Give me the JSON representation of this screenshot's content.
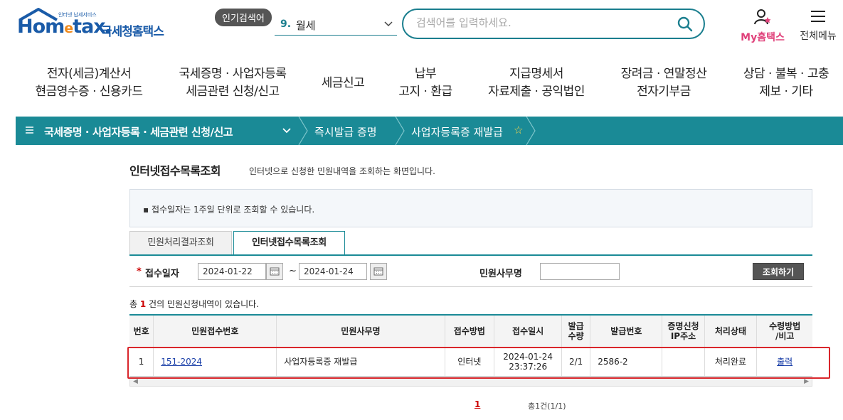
{
  "header": {
    "logo_main": "Hom",
    "logo_e": "e",
    "logo_rest": "tax.",
    "logo_small": "인터넷 납세서비스",
    "logo_sub": "국세청홈택스",
    "popular_badge": "인기검색어",
    "popular_num": "9.",
    "popular_text": "월세",
    "search_placeholder": "검색어를 입력하세요.",
    "my_hometax": "My홈택스",
    "all_menu": "전체메뉴"
  },
  "main_nav": [
    {
      "line1": "전자(세금)계산서",
      "line2": "현금영수증 · 신용카드"
    },
    {
      "line1": "국세증명 · 사업자등록",
      "line2": "세금관련 신청/신고"
    },
    {
      "line1": "세금신고",
      "line2": ""
    },
    {
      "line1": "납부",
      "line2": "고지 · 환급"
    },
    {
      "line1": "지급명세서",
      "line2": "자료제출 · 공익법인"
    },
    {
      "line1": "장려금 · 연말정산",
      "line2": "전자기부금"
    },
    {
      "line1": "상담 · 불복 · 고충",
      "line2": "제보 · 기타"
    }
  ],
  "breadcrumb": {
    "level1": "국세증명 · 사업자등록 · 세금관련 신청/신고",
    "level2": "즉시발급 증명",
    "level3": "사업자등록증 재발급",
    "star": "☆"
  },
  "page": {
    "title": "인터넷접수목록조회",
    "desc": "인터넷으로 신청한 민원내역을 조회하는 화면입니다.",
    "notice": "▪ 접수일자는 1주일 단위로 조회할 수 있습니다."
  },
  "tabs": [
    {
      "label": "민원처리결과조회"
    },
    {
      "label": "인터넷접수목록조회"
    }
  ],
  "filter": {
    "required_mark": "*",
    "date_label": "접수일자",
    "date_from": "2024-01-22",
    "tilde": "~",
    "date_to": "2024-01-24",
    "name_label": "민원사무명",
    "name_value": "",
    "search_button": "조회하기"
  },
  "count": {
    "prefix": "총 ",
    "num": "1",
    "suffix": " 건의 민원신청내역이 있습니다."
  },
  "table": {
    "headers": [
      "번호",
      "민원접수번호",
      "민원사무명",
      "접수방법",
      "접수일시",
      "발급수량",
      "발급번호",
      "증명신청IP주소",
      "처리상태",
      "수령방법/비고"
    ],
    "header_lines": [
      [
        "번호"
      ],
      [
        "민원접수번호"
      ],
      [
        "민원사무명"
      ],
      [
        "접수방법"
      ],
      [
        "접수일시"
      ],
      [
        "발급",
        "수량"
      ],
      [
        "발급번호"
      ],
      [
        "증명신청",
        "IP주소"
      ],
      [
        "처리상태"
      ],
      [
        "수령방법",
        "/비고"
      ]
    ],
    "rows": [
      {
        "no": "1",
        "receipt_no": "151-2024",
        "name": "사업자등록증 재발급",
        "method": "인터넷",
        "date": "2024-01-24",
        "time": "23:37:26",
        "qty": "2/1",
        "issue_no": "2586-2",
        "issue_no_tail": "",
        "ip": "",
        "status": "처리완료",
        "receive": "출력"
      }
    ]
  },
  "pager": {
    "current": "1",
    "total": "총1건(1/1)"
  },
  "colors": {
    "brand_teal": "#1a8a96",
    "highlight_red": "#d9262b",
    "my_pink": "#e0427b",
    "logo_blue": "#1a5ba8",
    "logo_orange": "#f08a1c"
  }
}
